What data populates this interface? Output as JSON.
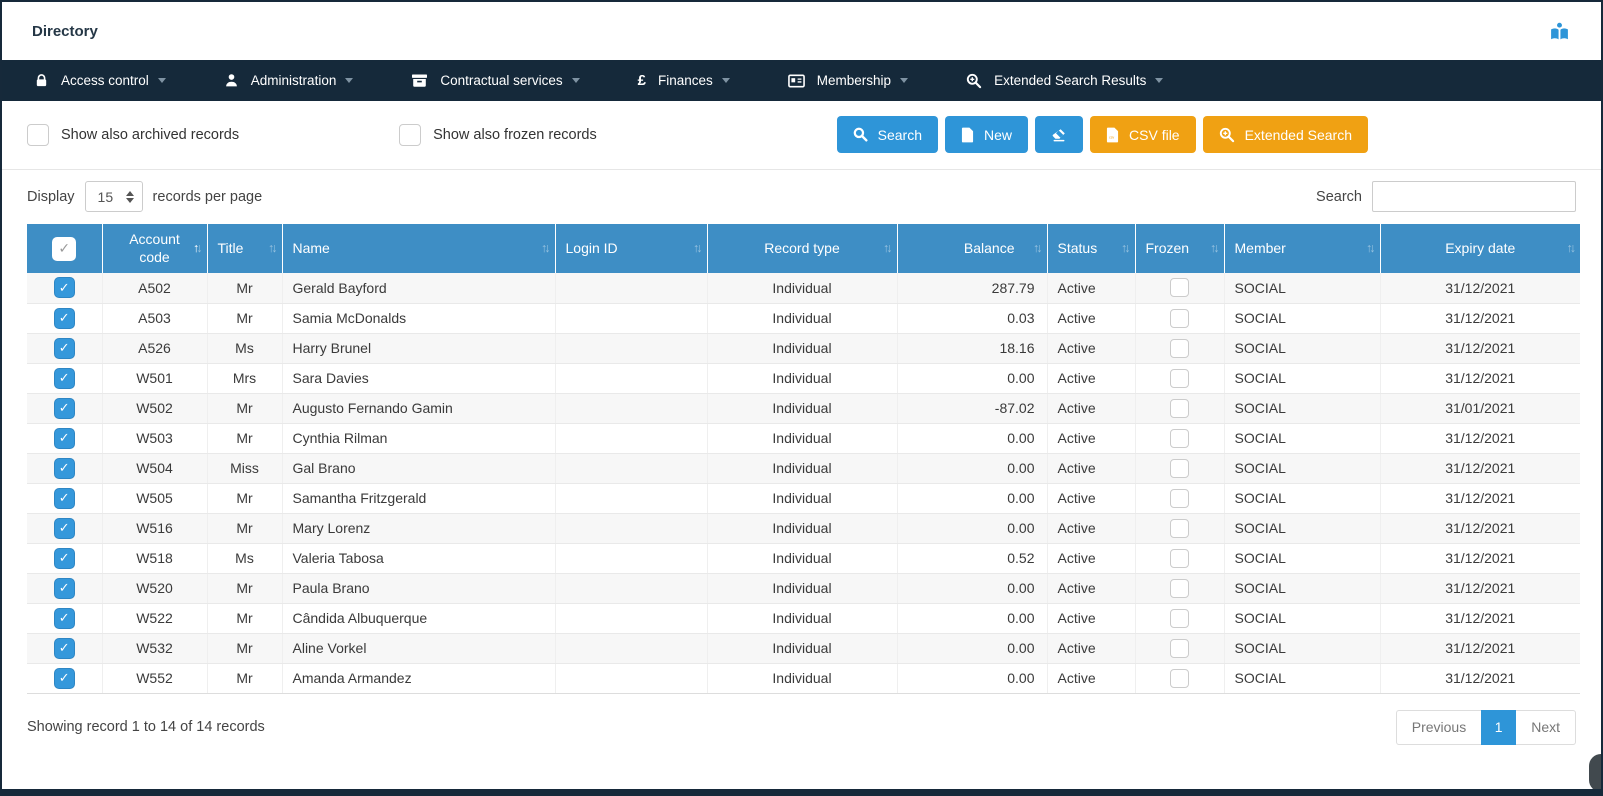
{
  "window": {
    "title": "Directory"
  },
  "colors": {
    "nav_bg": "#15293a",
    "header_blue": "#3e8ec5",
    "button_blue": "#2e95d8",
    "button_orange": "#f0a113",
    "checkbox_blue": "#3598db"
  },
  "nav": {
    "items": [
      {
        "label": "Access control",
        "icon": "lock-icon"
      },
      {
        "label": "Administration",
        "icon": "user-icon"
      },
      {
        "label": "Contractual services",
        "icon": "archive-icon"
      },
      {
        "label": "Finances",
        "icon": "pound-icon"
      },
      {
        "label": "Membership",
        "icon": "id-card-icon"
      },
      {
        "label": "Extended Search Results",
        "icon": "search-plus-icon"
      }
    ]
  },
  "header_actions": {
    "reader_icon": "reader-icon"
  },
  "toolbar": {
    "checkboxes": [
      {
        "label": "Show also archived records",
        "checked": false
      },
      {
        "label": "Show also frozen records",
        "checked": false
      }
    ],
    "buttons": [
      {
        "label": "Search",
        "style": "blue",
        "icon": "search-icon"
      },
      {
        "label": "New",
        "style": "blue",
        "icon": "file-icon"
      },
      {
        "label": "",
        "style": "blue",
        "icon": "eraser-icon"
      },
      {
        "label": "CSV file",
        "style": "orange",
        "icon": "csv-file-icon"
      },
      {
        "label": "Extended Search",
        "style": "orange",
        "icon": "search-plus-icon"
      }
    ]
  },
  "display_bar": {
    "display_label": "Display",
    "page_size": "15",
    "records_label": "records per page",
    "search_label": "Search",
    "search_value": ""
  },
  "table": {
    "select_all_checked": true,
    "sorted_column": "Account code",
    "sorted_dir": "asc",
    "columns": [
      "Account code",
      "Title",
      "Name",
      "Login ID",
      "Record type",
      "Balance",
      "Status",
      "Frozen",
      "Member",
      "Expiry date"
    ],
    "rows": [
      {
        "selected": true,
        "account_code": "A502",
        "title": "Mr",
        "name": "Gerald Bayford",
        "login_id": "",
        "record_type": "Individual",
        "balance": "287.79",
        "status": "Active",
        "frozen": false,
        "member": "SOCIAL",
        "expiry_date": "31/12/2021"
      },
      {
        "selected": true,
        "account_code": "A503",
        "title": "Mr",
        "name": "Samia McDonalds",
        "login_id": "",
        "record_type": "Individual",
        "balance": "0.03",
        "status": "Active",
        "frozen": false,
        "member": "SOCIAL",
        "expiry_date": "31/12/2021"
      },
      {
        "selected": true,
        "account_code": "A526",
        "title": "Ms",
        "name": "Harry Brunel",
        "login_id": "",
        "record_type": "Individual",
        "balance": "18.16",
        "status": "Active",
        "frozen": false,
        "member": "SOCIAL",
        "expiry_date": "31/12/2021"
      },
      {
        "selected": true,
        "account_code": "W501",
        "title": "Mrs",
        "name": "Sara Davies",
        "login_id": "",
        "record_type": "Individual",
        "balance": "0.00",
        "status": "Active",
        "frozen": false,
        "member": "SOCIAL",
        "expiry_date": "31/12/2021"
      },
      {
        "selected": true,
        "account_code": "W502",
        "title": "Mr",
        "name": "Augusto Fernando Gamin",
        "login_id": "",
        "record_type": "Individual",
        "balance": "-87.02",
        "status": "Active",
        "frozen": false,
        "member": "SOCIAL",
        "expiry_date": "31/01/2021"
      },
      {
        "selected": true,
        "account_code": "W503",
        "title": "Mr",
        "name": "Cynthia Rilman",
        "login_id": "",
        "record_type": "Individual",
        "balance": "0.00",
        "status": "Active",
        "frozen": false,
        "member": "SOCIAL",
        "expiry_date": "31/12/2021"
      },
      {
        "selected": true,
        "account_code": "W504",
        "title": "Miss",
        "name": "Gal Brano",
        "login_id": "",
        "record_type": "Individual",
        "balance": "0.00",
        "status": "Active",
        "frozen": false,
        "member": "SOCIAL",
        "expiry_date": "31/12/2021"
      },
      {
        "selected": true,
        "account_code": "W505",
        "title": "Mr",
        "name": "Samantha Fritzgerald",
        "login_id": "",
        "record_type": "Individual",
        "balance": "0.00",
        "status": "Active",
        "frozen": false,
        "member": "SOCIAL",
        "expiry_date": "31/12/2021"
      },
      {
        "selected": true,
        "account_code": "W516",
        "title": "Mr",
        "name": "Mary Lorenz",
        "login_id": "",
        "record_type": "Individual",
        "balance": "0.00",
        "status": "Active",
        "frozen": false,
        "member": "SOCIAL",
        "expiry_date": "31/12/2021"
      },
      {
        "selected": true,
        "account_code": "W518",
        "title": "Ms",
        "name": "Valeria Tabosa",
        "login_id": "",
        "record_type": "Individual",
        "balance": "0.52",
        "status": "Active",
        "frozen": false,
        "member": "SOCIAL",
        "expiry_date": "31/12/2021"
      },
      {
        "selected": true,
        "account_code": "W520",
        "title": "Mr",
        "name": "Paula Brano",
        "login_id": "",
        "record_type": "Individual",
        "balance": "0.00",
        "status": "Active",
        "frozen": false,
        "member": "SOCIAL",
        "expiry_date": "31/12/2021"
      },
      {
        "selected": true,
        "account_code": "W522",
        "title": "Mr",
        "name": "Cândida Albuquerque",
        "login_id": "",
        "record_type": "Individual",
        "balance": "0.00",
        "status": "Active",
        "frozen": false,
        "member": "SOCIAL",
        "expiry_date": "31/12/2021"
      },
      {
        "selected": true,
        "account_code": "W532",
        "title": "Mr",
        "name": "Aline Vorkel",
        "login_id": "",
        "record_type": "Individual",
        "balance": "0.00",
        "status": "Active",
        "frozen": false,
        "member": "SOCIAL",
        "expiry_date": "31/12/2021"
      },
      {
        "selected": true,
        "account_code": "W552",
        "title": "Mr",
        "name": "Amanda Armandez",
        "login_id": "",
        "record_type": "Individual",
        "balance": "0.00",
        "status": "Active",
        "frozen": false,
        "member": "SOCIAL",
        "expiry_date": "31/12/2021"
      }
    ]
  },
  "footer": {
    "summary": "Showing record 1 to 14 of 14 records",
    "pagination": {
      "previous": "Previous",
      "current": "1",
      "next": "Next"
    }
  }
}
